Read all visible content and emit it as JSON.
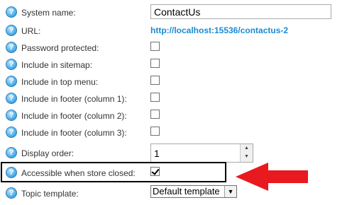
{
  "fields": {
    "system_name": {
      "label": "System name:",
      "value": "ContactUs"
    },
    "url": {
      "label": "URL:",
      "value": "http://localhost:15536/contactus-2"
    },
    "password_protected": {
      "label": "Password protected:",
      "checked": false
    },
    "include_in_sitemap": {
      "label": "Include in sitemap:",
      "checked": false
    },
    "include_in_top_menu": {
      "label": "Include in top menu:",
      "checked": false
    },
    "include_in_footer_1": {
      "label": "Include in footer (column 1):",
      "checked": false
    },
    "include_in_footer_2": {
      "label": "Include in footer (column 2):",
      "checked": false
    },
    "include_in_footer_3": {
      "label": "Include in footer (column 3):",
      "checked": false
    },
    "display_order": {
      "label": "Display order:",
      "value": "1"
    },
    "accessible_when_store_closed": {
      "label": "Accessible when store closed:",
      "checked": true
    },
    "topic_template": {
      "label": "Topic template:",
      "value": "Default template"
    }
  },
  "icons": {
    "help": "help-icon",
    "spin_up": "▲",
    "spin_down": "▼",
    "dropdown": "▼"
  },
  "colors": {
    "link": "#1b8bd0",
    "annotation_arrow": "#e8191f",
    "help_icon": "#56b3ea"
  }
}
